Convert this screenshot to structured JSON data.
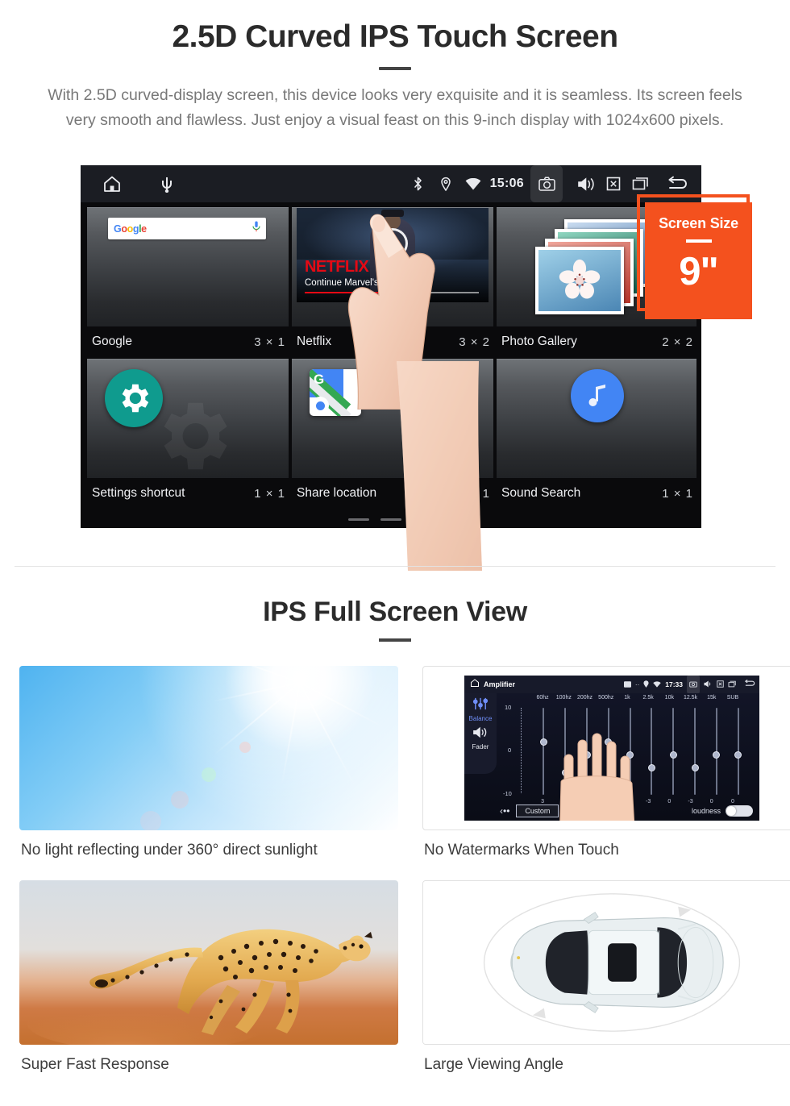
{
  "section1": {
    "title": "2.5D Curved IPS Touch Screen",
    "description": "With 2.5D curved-display screen, this device looks very exquisite and it is seamless. Its screen feels very smooth and flawless. Just enjoy a visual feast on this 9-inch display with 1024x600 pixels."
  },
  "device_screen": {
    "statusbar": {
      "left_icons": [
        "home-icon",
        "usb-icon"
      ],
      "bluetooth_icon": "bluetooth-icon",
      "location_icon": "location-icon",
      "wifi_icon": "wifi-icon",
      "time": "15:06",
      "right_icons": [
        "camera-icon",
        "volume-icon",
        "mute-icon",
        "recents-icon",
        "back-icon"
      ]
    },
    "widgets": [
      {
        "name": "Google",
        "size": "3 × 1",
        "icon": "google-search-widget",
        "search_placeholder": "Google",
        "mic_icon": "microphone-icon"
      },
      {
        "name": "Netflix",
        "size": "3 × 2",
        "icon": "netflix-widget",
        "brand": "NETFLIX",
        "caption": "Continue Marvel's Daredevil",
        "play_icon": "play-icon"
      },
      {
        "name": "Photo Gallery",
        "size": "2 × 2",
        "icon": "photo-gallery-widget"
      },
      {
        "name": "Settings shortcut",
        "size": "1 × 1",
        "icon": "gear-icon"
      },
      {
        "name": "Share location",
        "size": "1 × 1",
        "icon": "google-maps-icon"
      },
      {
        "name": "Sound Search",
        "size": "1 × 1",
        "icon": "music-note-icon"
      }
    ],
    "page_dots": 3,
    "active_dot": 3
  },
  "screen_size_badge": {
    "label": "Screen Size",
    "value": "9\"",
    "color": "#f4511e"
  },
  "section2": {
    "title": "IPS Full Screen View",
    "cards": [
      {
        "caption": "No light reflecting under 360° direct sunlight",
        "media": "sunlight-sky-photo"
      },
      {
        "caption": "No Watermarks When Touch",
        "media": "amplifier-equalizer-screen"
      },
      {
        "caption": "Super Fast Response",
        "media": "running-cheetah-photo"
      },
      {
        "caption": "Large Viewing Angle",
        "media": "car-top-view-illustration"
      }
    ]
  },
  "amplifier": {
    "title": "Amplifier",
    "time": "17:33",
    "sidebar": [
      {
        "label": "Balance",
        "icon": "sliders-icon"
      },
      {
        "label": "Fader",
        "icon": "speaker-icon"
      }
    ],
    "scale": [
      "10",
      "0",
      "-10"
    ],
    "bands": [
      "60hz",
      "100hz",
      "200hz",
      "500hz",
      "1k",
      "2.5k",
      "10k",
      "12.5k",
      "15k",
      "SUB"
    ],
    "values": [
      "3",
      "-4",
      "0",
      "3",
      "0",
      "-3",
      "0",
      "-3",
      "0",
      "0"
    ],
    "preset_label": "Custom",
    "loudness_label": "loudness",
    "prev_icon": "chevron-left-icon",
    "toggle_state": "off"
  }
}
